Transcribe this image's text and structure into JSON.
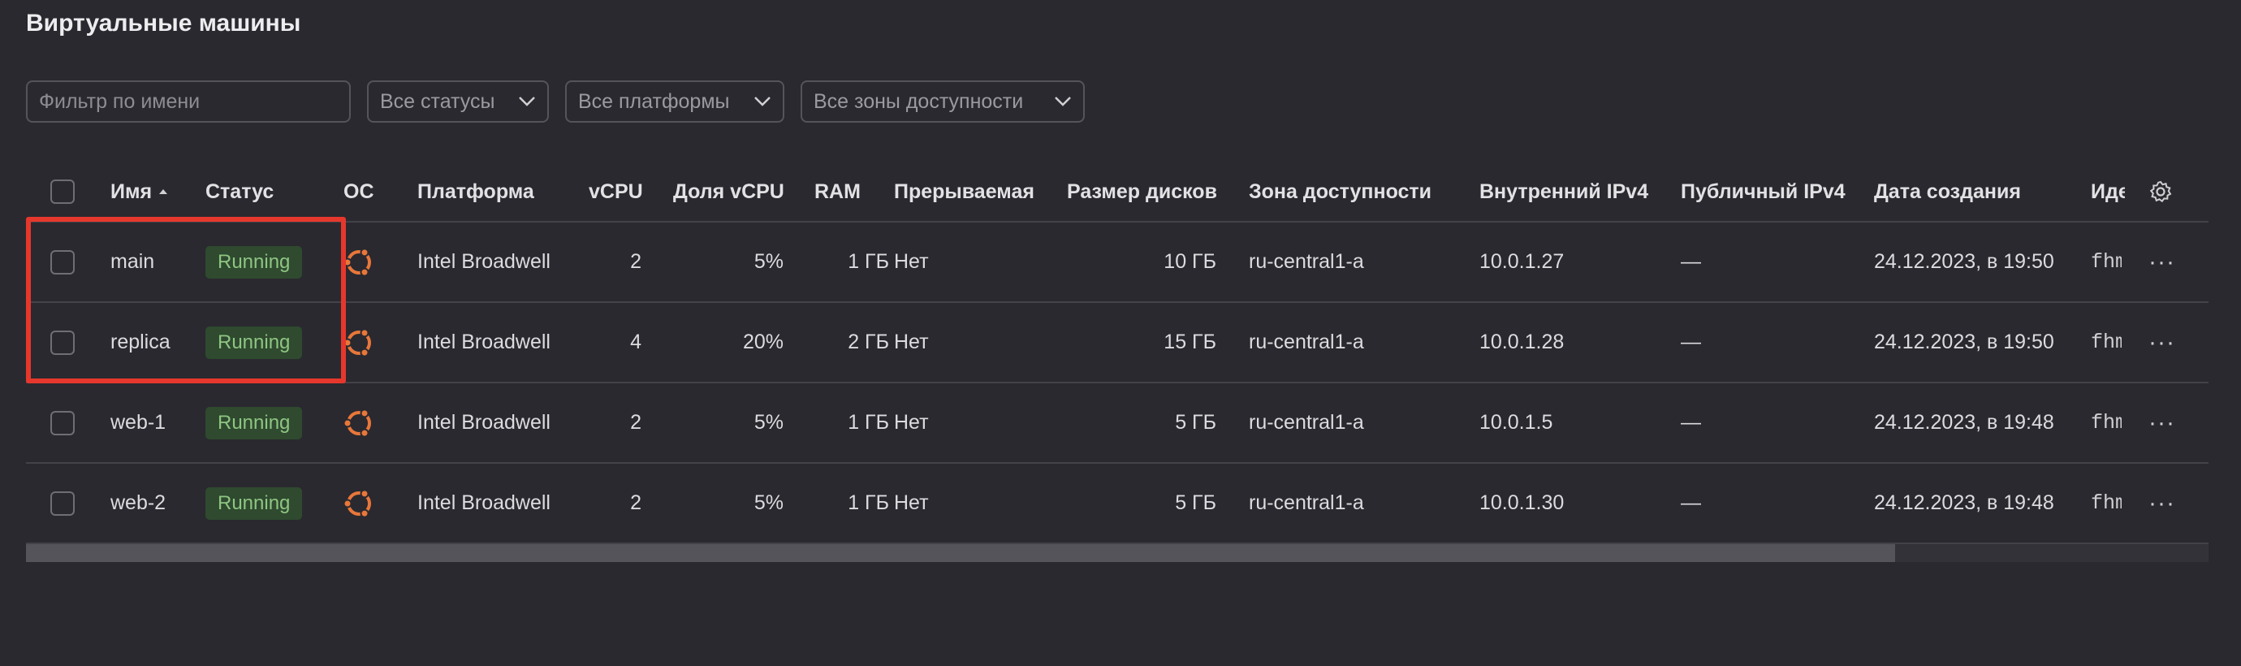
{
  "page": {
    "title": "Виртуальные машины"
  },
  "filters": {
    "name_placeholder": "Фильтр по имени",
    "status": "Все статусы",
    "platform": "Все платформы",
    "zone": "Все зоны доступности"
  },
  "columns": {
    "name": "Имя",
    "status": "Статус",
    "os": "ОС",
    "platform": "Платформа",
    "vcpu": "vCPU",
    "vcpu_share": "Доля vCPU",
    "ram": "RAM",
    "preemptible": "Прерываемая",
    "disk_size": "Размер дисков",
    "zone": "Зона доступности",
    "internal_ip": "Внутренний IPv4",
    "public_ip": "Публичный IPv4",
    "created": "Дата создания",
    "id": "Иде"
  },
  "rows": [
    {
      "name": "main",
      "status": "Running",
      "platform": "Intel Broadwell",
      "vcpu": "2",
      "vcpu_share": "5%",
      "ram": "1 ГБ",
      "preemptible": "Нет",
      "disk_size": "10 ГБ",
      "zone": "ru-central1-a",
      "internal_ip": "10.0.1.27",
      "public_ip": "—",
      "created": "24.12.2023, в 19:50",
      "id": "fhm"
    },
    {
      "name": "replica",
      "status": "Running",
      "platform": "Intel Broadwell",
      "vcpu": "4",
      "vcpu_share": "20%",
      "ram": "2 ГБ",
      "preemptible": "Нет",
      "disk_size": "15 ГБ",
      "zone": "ru-central1-a",
      "internal_ip": "10.0.1.28",
      "public_ip": "—",
      "created": "24.12.2023, в 19:50",
      "id": "fhm"
    },
    {
      "name": "web-1",
      "status": "Running",
      "platform": "Intel Broadwell",
      "vcpu": "2",
      "vcpu_share": "5%",
      "ram": "1 ГБ",
      "preemptible": "Нет",
      "disk_size": "5 ГБ",
      "zone": "ru-central1-a",
      "internal_ip": "10.0.1.5",
      "public_ip": "—",
      "created": "24.12.2023, в 19:48",
      "id": "fhm"
    },
    {
      "name": "web-2",
      "status": "Running",
      "platform": "Intel Broadwell",
      "vcpu": "2",
      "vcpu_share": "5%",
      "ram": "1 ГБ",
      "preemptible": "Нет",
      "disk_size": "5 ГБ",
      "zone": "ru-central1-a",
      "internal_ip": "10.0.1.30",
      "public_ip": "—",
      "created": "24.12.2023, в 19:48",
      "id": "fhm"
    }
  ],
  "actions": {
    "more": "···"
  },
  "colors": {
    "background": "#2a292f",
    "status_running_bg": "#2f4a2f",
    "status_running_text": "#8ec582",
    "os_icon": "#e8773a",
    "highlight": "#e6372c"
  },
  "icons": {
    "os": "ubuntu-icon",
    "settings": "gear-icon",
    "sort": "sort-asc-icon",
    "dropdown": "chevron-down-icon",
    "row_menu": "more-horizontal-icon"
  }
}
